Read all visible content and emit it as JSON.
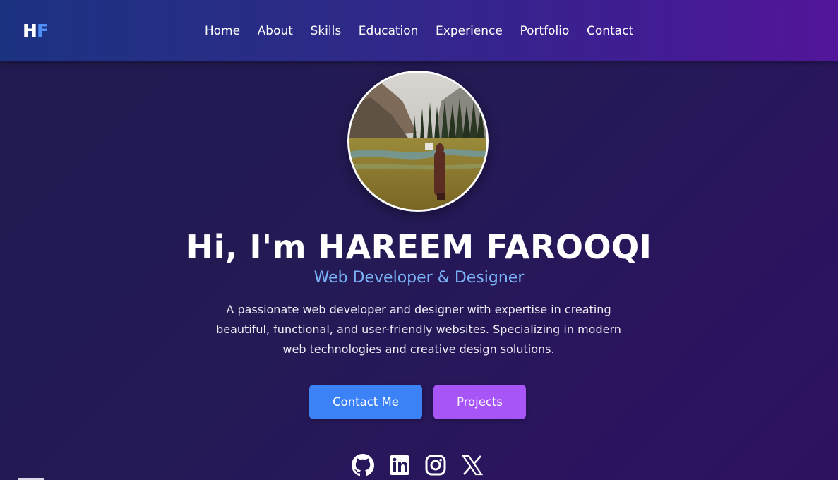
{
  "nav": {
    "logo_part1": "H",
    "logo_part2": "F",
    "links": [
      "Home",
      "About",
      "Skills",
      "Education",
      "Experience",
      "Portfolio",
      "Contact"
    ]
  },
  "hero": {
    "title": "Hi, I'm HAREEM FAROOQI",
    "subtitle": "Web Developer & Designer",
    "description": "A passionate web developer and designer with expertise in creating beautiful, functional, and user-friendly websites. Specializing in modern web technologies and creative design solutions.",
    "contact_button": "Contact Me",
    "projects_button": "Projects"
  },
  "social_icons": [
    "github-icon",
    "linkedin-icon",
    "instagram-icon",
    "x-icon"
  ],
  "colors": {
    "accent_blue": "#3b82f6",
    "accent_purple": "#a855f7",
    "subtitle_blue": "#7ab3f7",
    "logo_blue": "#4f8ff7"
  }
}
